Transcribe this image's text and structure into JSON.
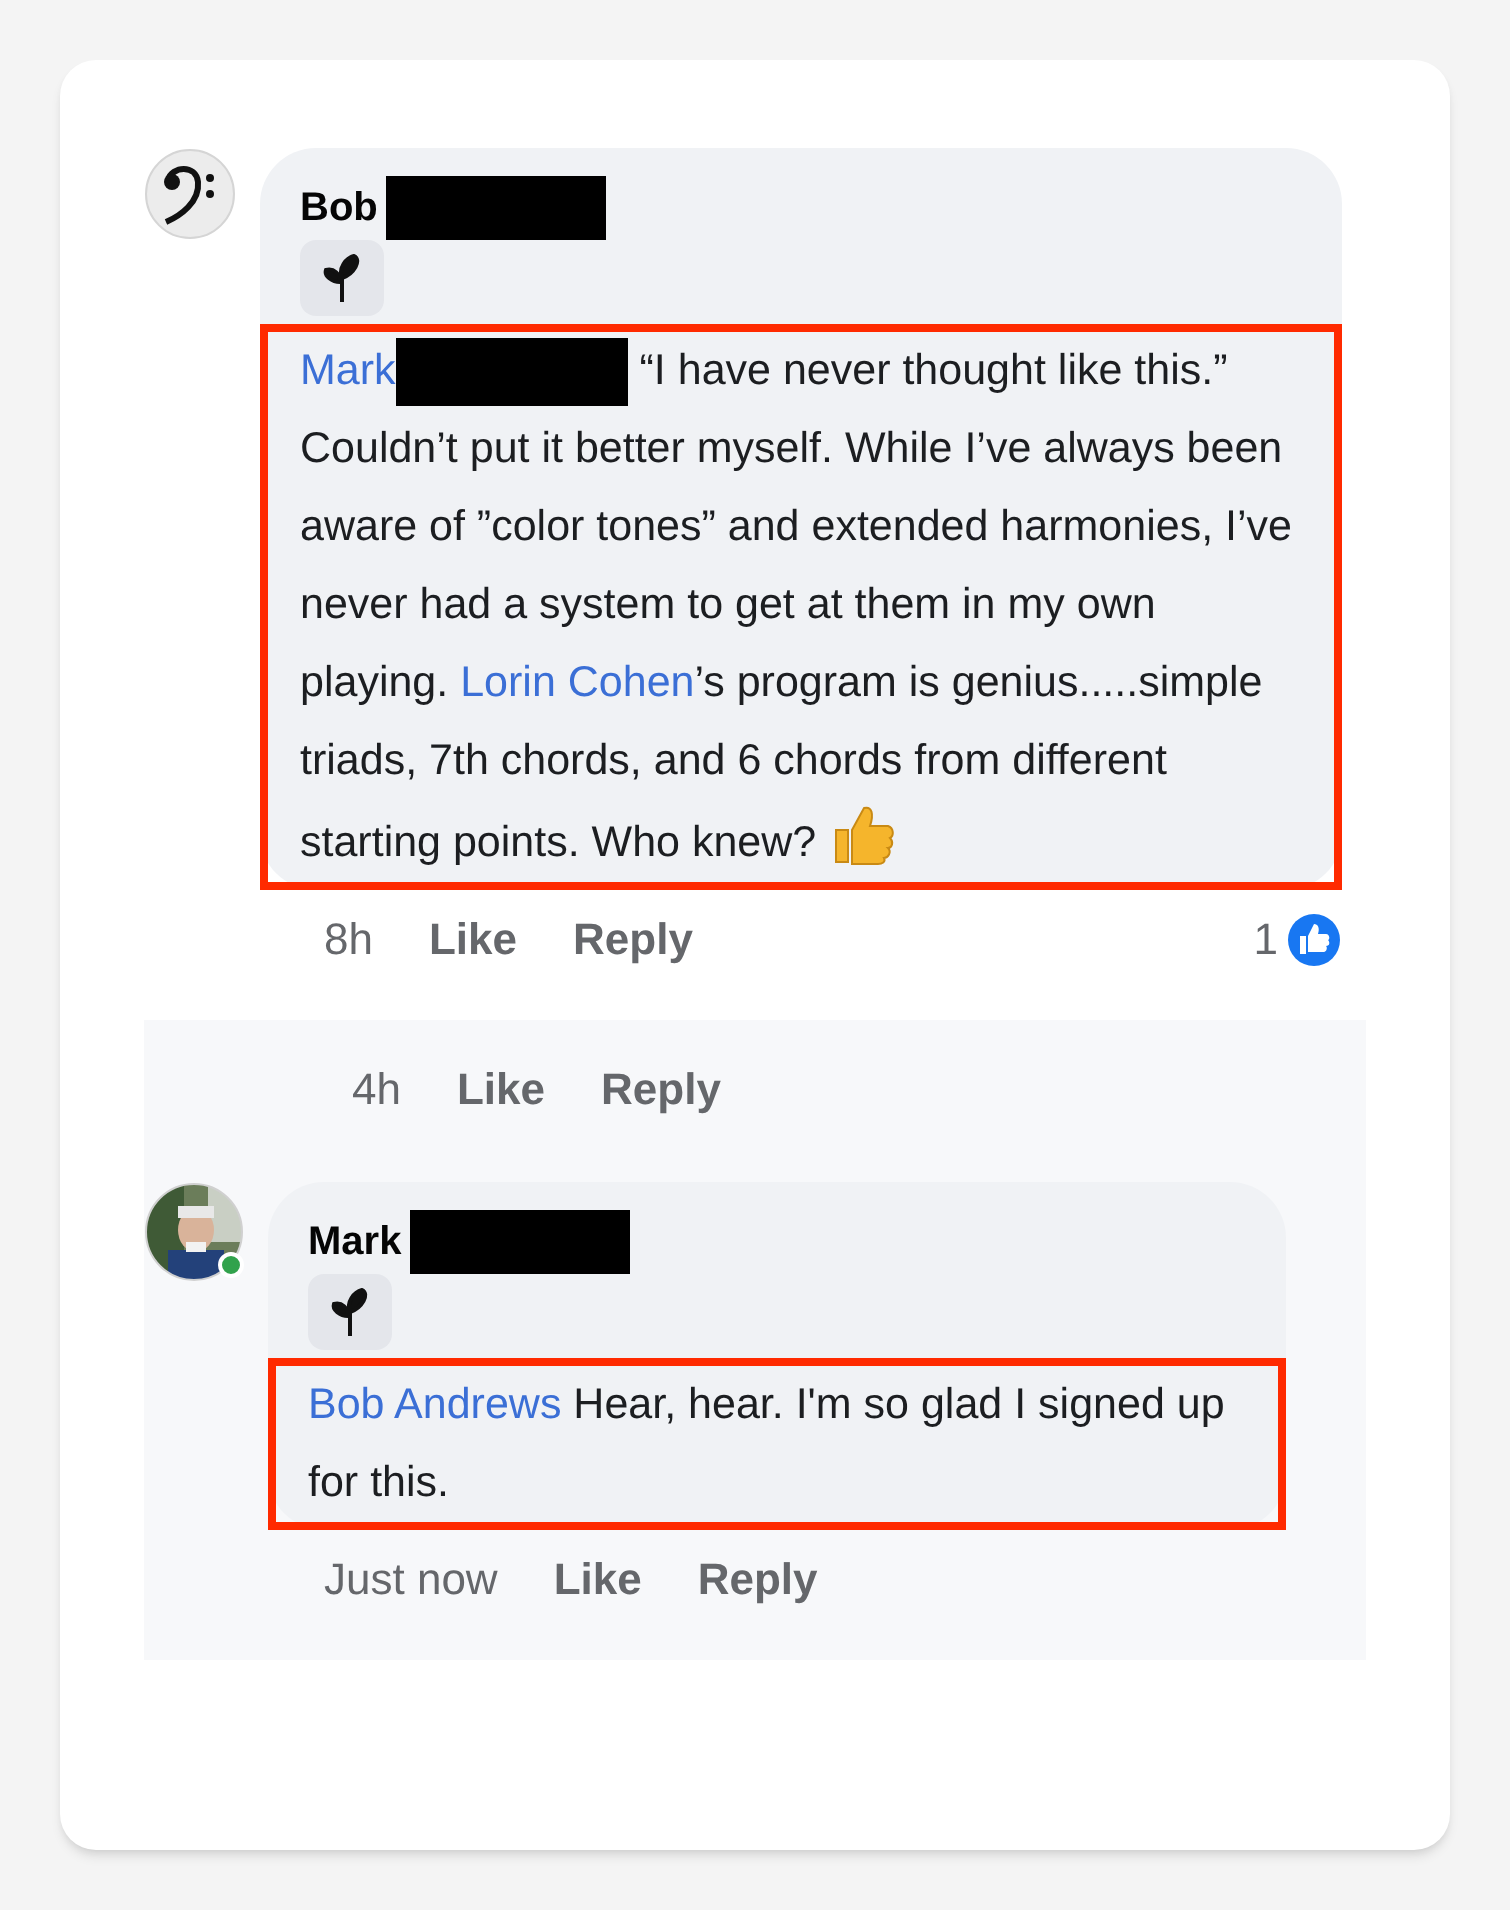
{
  "threads": [
    {
      "comment": {
        "author": "Bob",
        "author_redacted": true,
        "avatar": {
          "kind": "clef"
        },
        "online": false,
        "highlighted": true,
        "segments": [
          {
            "kind": "mention",
            "text": "Mark"
          },
          {
            "kind": "redacted"
          },
          {
            "kind": "text",
            "text": " “I have never thought like this.” Couldn’t put it better myself. While I’ve always been aware of ”color tones” and extended harmonies, I’ve never had a system to get at them in my own playing. "
          },
          {
            "kind": "mention",
            "text": "Lorin Cohen"
          },
          {
            "kind": "text",
            "text": "’s program is genius.....simple triads, 7th chords, and 6 chords from different starting points. Who knew? "
          },
          {
            "kind": "emoji"
          }
        ]
      },
      "meta": {
        "time": "8h",
        "actions": [
          "Like",
          "Reply"
        ],
        "reactions": "1"
      }
    },
    {
      "meta": {
        "time": "4h",
        "actions": [
          "Like",
          "Reply"
        ]
      }
    },
    {
      "comment": {
        "author": "Mark",
        "author_redacted": true,
        "online": true,
        "highlighted": true,
        "segments": [
          {
            "kind": "mention",
            "text": "Bob Andrews"
          },
          {
            "kind": "text",
            "text": " Hear, hear.  I'm so glad I signed up for this."
          }
        ]
      },
      "meta": {
        "time": "Just now",
        "actions": [
          "Like",
          "Reply"
        ]
      }
    }
  ]
}
